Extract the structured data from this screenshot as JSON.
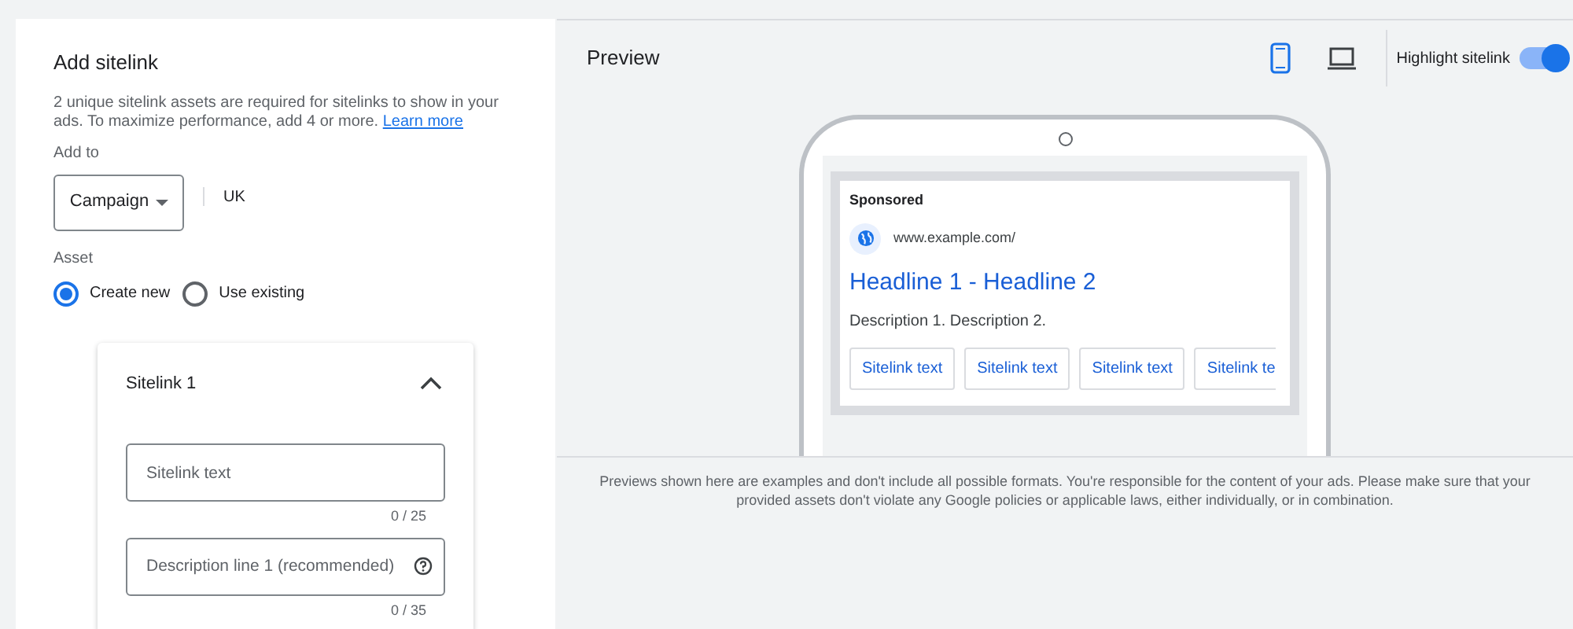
{
  "form": {
    "title": "Add sitelink",
    "intro": "2 unique sitelink assets are required for sitelinks to show in your ads. To maximize performance, add 4 or more.",
    "learn_more": "Learn more",
    "add_to_label": "Add to",
    "add_to_value": "Campaign",
    "campaign": "UK",
    "asset_label": "Asset",
    "asset_options": [
      {
        "label": "Create new",
        "selected": true
      },
      {
        "label": "Use existing",
        "selected": false
      }
    ],
    "sitelink": {
      "title": "Sitelink 1",
      "expanded": true,
      "fields": [
        {
          "placeholder": "Sitelink text",
          "counter": "0 / 25",
          "help": false
        },
        {
          "placeholder": "Description line 1 (recommended)",
          "counter": "0 / 35",
          "help": true
        }
      ]
    }
  },
  "preview": {
    "title": "Preview",
    "devices": [
      {
        "kind": "mobile",
        "selected": true
      },
      {
        "kind": "desktop",
        "selected": false
      }
    ],
    "highlight_label": "Highlight sitelink",
    "highlight_on": true,
    "ad": {
      "sponsored": "Sponsored",
      "url": "www.example.com/",
      "headline": "Headline 1 - Headline 2",
      "description": "Description 1. Description 2.",
      "sitelinks": [
        "Sitelink text",
        "Sitelink text",
        "Sitelink text",
        "Sitelink te"
      ]
    },
    "disclaimer": "Previews shown here are examples and don't include all possible formats. You're responsible for the content of your ads. Please make sure that your provided assets don't violate any Google policies or applicable laws, either individually, or in combination."
  }
}
